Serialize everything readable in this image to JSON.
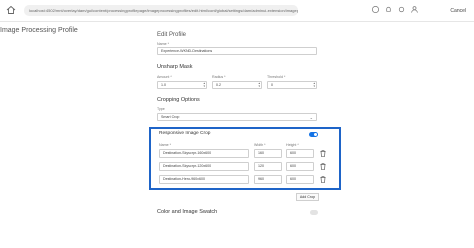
{
  "browser": {
    "url": "localhost:4502/mnt/overlay/dam/gui/content/processingprofilepage/imageprocessingprofiles/edit.html/conf/global/settings/dam/adminui-extension/imageprofile/..."
  },
  "header": {
    "cancel_label": "Cancel"
  },
  "page": {
    "title": "Image Processing Profile"
  },
  "edit_profile": {
    "section_title": "Edit Profile",
    "name_label": "Name *",
    "name_value": "Experience-WKND-Destinations"
  },
  "unsharp_mask": {
    "section_title": "Unsharp Mask",
    "amount_label": "Amount *",
    "amount_value": "1.0",
    "radius_label": "Radius *",
    "radius_value": "0.2",
    "threshold_label": "Threshold *",
    "threshold_value": "0"
  },
  "cropping_options": {
    "section_title": "Cropping Options",
    "type_label": "Type",
    "type_value": "Smart Crop"
  },
  "responsive_crop": {
    "section_title": "Responsive Image Crop",
    "toggle_on": true,
    "col_name": "Name *",
    "col_width": "Width *",
    "col_height": "Height *",
    "rows": [
      {
        "name": "Destination-Skyscrpr-160x600",
        "width": "160",
        "height": "600"
      },
      {
        "name": "Destination-Skyscrpr-120x600",
        "width": "120",
        "height": "600"
      },
      {
        "name": "Destination-Hero-960x600",
        "width": "960",
        "height": "600"
      }
    ],
    "add_label": "Add Crop"
  },
  "color_swatch": {
    "section_title": "Color and Image Swatch",
    "toggle_on": false
  },
  "colors": {
    "highlight": "#1e64c8",
    "toggle_on": "#1473e6"
  }
}
